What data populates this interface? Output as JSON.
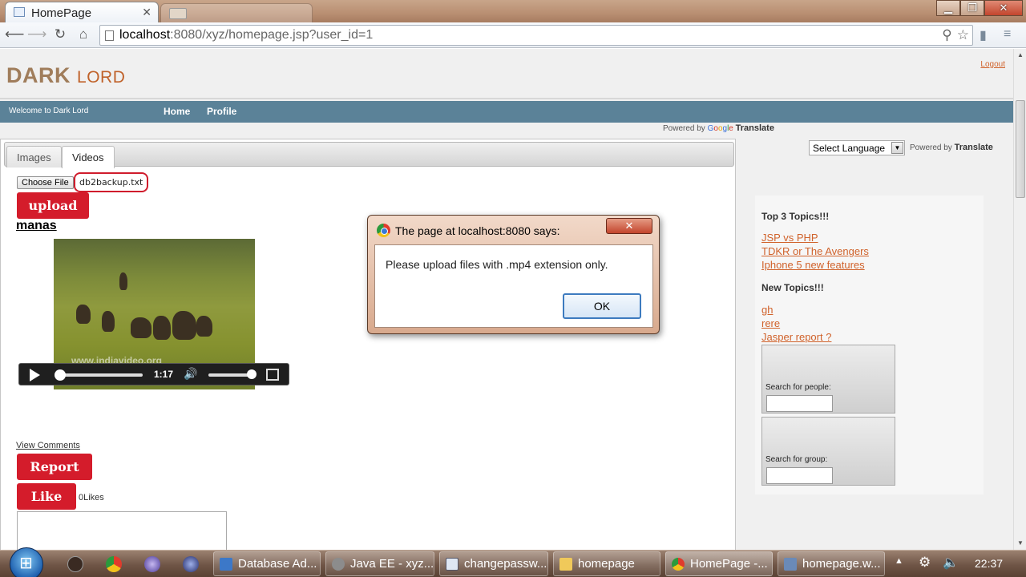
{
  "browser": {
    "tab_title": "HomePage",
    "url_host": "localhost",
    "url_path": ":8080/xyz/homepage.jsp?user_id=1"
  },
  "header": {
    "logo_dark": "DARK",
    "logo_lord": "LORD",
    "logout": "Logout"
  },
  "menubar": {
    "welcome": "Welcome to Dark Lord",
    "home": "Home",
    "profile": "Profile"
  },
  "translate": {
    "powered_by": "Powered by",
    "google": [
      "G",
      "o",
      "o",
      "g",
      "l",
      "e"
    ],
    "translate": "Translate",
    "select_language": "Select Language"
  },
  "main": {
    "tabs": [
      "Images",
      "Videos"
    ],
    "active_tab": "Videos",
    "choose_file": "Choose File",
    "file_name": "db2backup.txt",
    "upload": "upload",
    "user_name": "manas",
    "video": {
      "watermark": "www.indiavideo.org",
      "time": "1:17"
    },
    "view_comments": "View Comments",
    "report": "Report",
    "like": "Like",
    "likes_count": "0Likes"
  },
  "sidebar": {
    "top_topics_heading": "Top 3 Topics!!!",
    "top_topics": [
      "JSP vs PHP",
      "TDKR or The Avengers",
      "Iphone 5 new features"
    ],
    "new_topics_heading": "New Topics!!!",
    "new_topics": [
      "gh",
      "rere",
      "Jasper report ?"
    ],
    "search_people_label": "Search for people:",
    "search_group_label": "Search for group:"
  },
  "dialog": {
    "title": "The page at localhost:8080 says:",
    "message": "Please upload files with .mp4 extension only.",
    "ok": "OK"
  },
  "taskbar": {
    "buttons": [
      "Database Ad...",
      "Java EE - xyz...",
      "changepassw...",
      "homepage",
      "HomePage -...",
      "homepage.w..."
    ],
    "clock": "22:37"
  }
}
